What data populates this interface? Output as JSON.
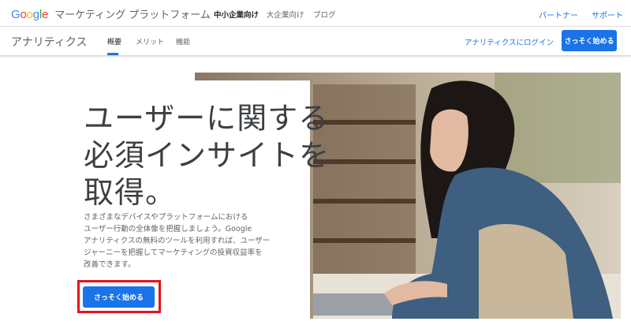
{
  "header": {
    "brand": "Google",
    "suite": "マーケティング プラットフォーム",
    "nav": [
      {
        "label": "中小企業向け",
        "active": true
      },
      {
        "label": "大企業向け",
        "active": false
      },
      {
        "label": "ブログ",
        "active": false
      }
    ],
    "links": {
      "partner": "パートナー",
      "support": "サポート"
    }
  },
  "subheader": {
    "product": "アナリティクス",
    "tabs": [
      {
        "label": "概要",
        "active": true
      },
      {
        "label": "メリット",
        "active": false
      },
      {
        "label": "機能",
        "active": false
      }
    ],
    "login": "アナリティクスにログイン",
    "start_button": "さっそく始める"
  },
  "hero": {
    "headline_lines": [
      "ユーザーに関する",
      "必須インサイトを",
      "取得。"
    ],
    "description_lines": [
      "さまざまなデバイスやプラットフォームにおける",
      "ユーザー行動の全体像を把握しましょう。Google",
      "アナリティクスの無料のツールを利用すれば、ユーザー",
      "ジャーニーを把握してマーケティングの投資収益率を",
      "改善できます。"
    ],
    "start_button": "さっそく始める"
  },
  "colors": {
    "accent": "#1a73e8",
    "highlight": "#e8111f",
    "google_blue": "#4285f4",
    "google_red": "#ea4335",
    "google_yellow": "#fbbc05",
    "google_green": "#34a853"
  }
}
